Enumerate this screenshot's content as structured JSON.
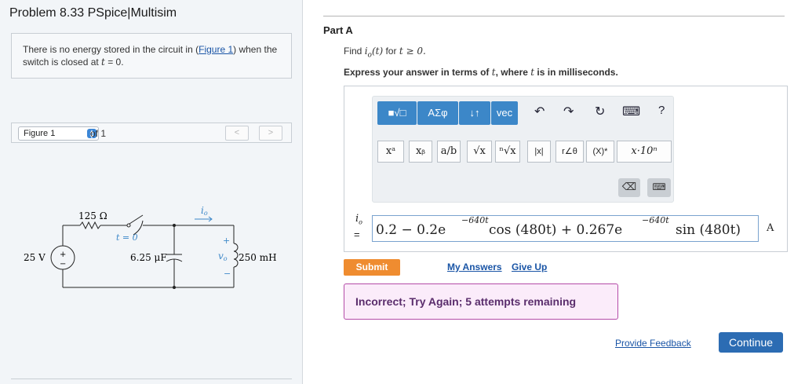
{
  "problem": {
    "title": "Problem 8.33 PSpice|Multisim"
  },
  "intro": {
    "text_before": "There is no energy stored in the circuit in (",
    "figure_link": "Figure 1",
    "text_middle": ") when the switch is closed at ",
    "time_var": "t",
    "text_after": " = 0."
  },
  "figure_nav": {
    "selected": "Figure 1",
    "of_text": "of 1",
    "prev_label": "<",
    "next_label": ">"
  },
  "circuit": {
    "source_label": "25 V",
    "resistor_label": "125 Ω",
    "switch_label": "t = 0",
    "capacitor_label": "6.25 μF",
    "inductor_label": "250 mH",
    "current_label": "i",
    "current_sub": "o",
    "voltage_label": "v",
    "voltage_sub": "o",
    "plus_sign": "+",
    "minus_sign": "−"
  },
  "part": {
    "label": "Part A"
  },
  "question": {
    "find": "Find ",
    "var_i": "i",
    "var_sub": "o",
    "paren": "(t)",
    "for": " for ",
    "cond": "t ≥ 0."
  },
  "instruction": {
    "before": "Express your answer in terms of ",
    "var1": "t",
    "middle": ", where ",
    "var2": "t",
    "after": " is in milliseconds."
  },
  "toolbar": {
    "group1": "■√□",
    "group2": "ΑΣφ",
    "group3": "↓↑",
    "group4": "vec",
    "undo": "↶",
    "redo": "↷",
    "reset": "↻",
    "keyboard": "⌨",
    "help": "?",
    "symbols": [
      "xᵃ",
      "xᵦ",
      "a/b",
      "√x",
      "ⁿ√x",
      "|x|",
      "r∠θ",
      "(X)*",
      "x·10ⁿ"
    ],
    "backspace": "⌫",
    "keypad": "⌨"
  },
  "answer": {
    "lhs_var": "i",
    "lhs_sub": "o",
    "lhs_eq": "=",
    "part1": "0.2 − 0.2e",
    "exp1": "−640t",
    "part2": "cos (480t) + 0.267e",
    "exp2": "−640t",
    "part3": "sin (480t)",
    "unit": "A"
  },
  "actions": {
    "submit": "Submit",
    "my_answers": "My Answers",
    "give_up": "Give Up"
  },
  "feedback": {
    "text": "Incorrect; Try Again; 5 attempts remaining"
  },
  "footer": {
    "provide_feedback": "Provide Feedback",
    "continue": "Continue"
  },
  "colors": {
    "toolbar_accent": "#3c87c8",
    "submit": "#ef8c30",
    "continue": "#2c6cb3",
    "feedback_border": "#b44ba8",
    "link": "#1a55a6"
  }
}
